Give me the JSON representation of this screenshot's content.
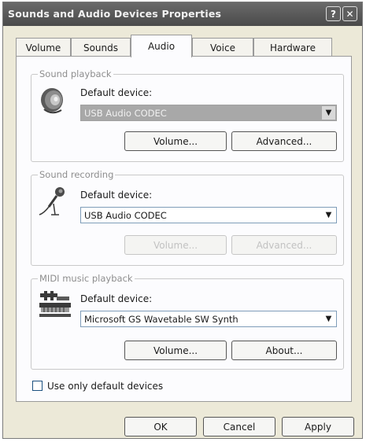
{
  "window": {
    "title": "Sounds and Audio Devices Properties",
    "help_button": "?",
    "close_button": "✕"
  },
  "tabs": [
    {
      "label": "Volume",
      "active": false
    },
    {
      "label": "Sounds",
      "active": false
    },
    {
      "label": "Audio",
      "active": true
    },
    {
      "label": "Voice",
      "active": false
    },
    {
      "label": "Hardware",
      "active": false
    }
  ],
  "playback": {
    "group_label": "Sound playback",
    "default_label": "Default device:",
    "device": "USB Audio CODEC",
    "volume_button": "Volume...",
    "advanced_button": "Advanced..."
  },
  "recording": {
    "group_label": "Sound recording",
    "default_label": "Default device:",
    "device": "USB Audio CODEC",
    "volume_button": "Volume...",
    "advanced_button": "Advanced..."
  },
  "midi": {
    "group_label": "MIDI music playback",
    "default_label": "Default device:",
    "device": "Microsoft GS Wavetable SW Synth",
    "volume_button": "Volume...",
    "about_button": "About..."
  },
  "use_default_only": {
    "label": "Use only default devices",
    "checked": false
  },
  "footer": {
    "ok": "OK",
    "cancel": "Cancel",
    "apply": "Apply"
  },
  "icons": {
    "playback": "speaker-icon",
    "recording": "microphone-icon",
    "midi": "midi-keyboard-icon",
    "dropdown": "chevron-down-icon"
  }
}
